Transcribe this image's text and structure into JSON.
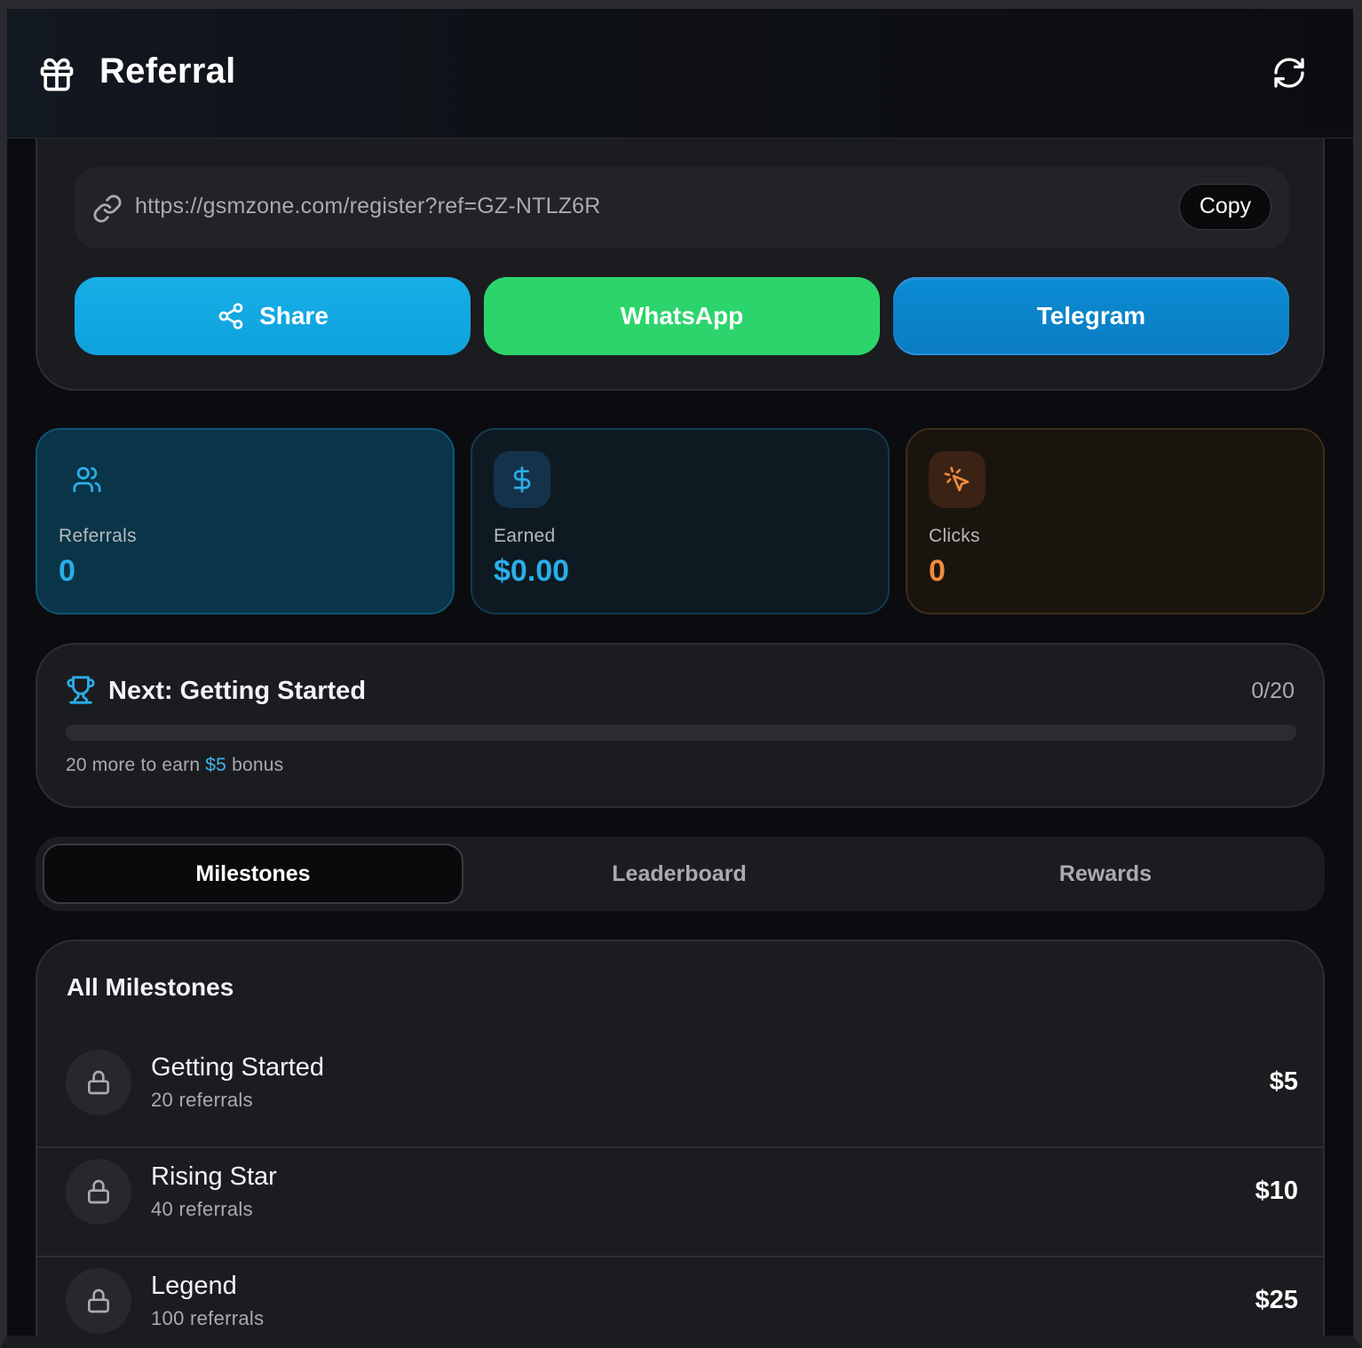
{
  "header": {
    "title": "Referral"
  },
  "link": {
    "url": "https://gsmzone.com/register?ref=GZ-NTLZ6R",
    "copy_label": "Copy"
  },
  "share_buttons": {
    "share": "Share",
    "whatsapp": "WhatsApp",
    "telegram": "Telegram"
  },
  "stats": {
    "referrals": {
      "label": "Referrals",
      "value": "0"
    },
    "earned": {
      "label": "Earned",
      "value": "$0.00"
    },
    "clicks": {
      "label": "Clicks",
      "value": "0"
    }
  },
  "next_milestone": {
    "title": "Next: Getting Started",
    "count": "0/20",
    "progress": 0,
    "note_prefix": "20 more to earn ",
    "note_amount": "$5",
    "note_suffix": " bonus"
  },
  "tabs": [
    "Milestones",
    "Leaderboard",
    "Rewards"
  ],
  "milestones": {
    "title": "All Milestones",
    "items": [
      {
        "name": "Getting Started",
        "requirement": "20 referrals",
        "reward": "$5"
      },
      {
        "name": "Rising Star",
        "requirement": "40 referrals",
        "reward": "$10"
      },
      {
        "name": "Legend",
        "requirement": "100 referrals",
        "reward": "$25"
      }
    ]
  },
  "colors": {
    "accent_blue": "#2aaee8",
    "whatsapp_green": "#2cd56b",
    "clicks_orange": "#f08a3a"
  }
}
